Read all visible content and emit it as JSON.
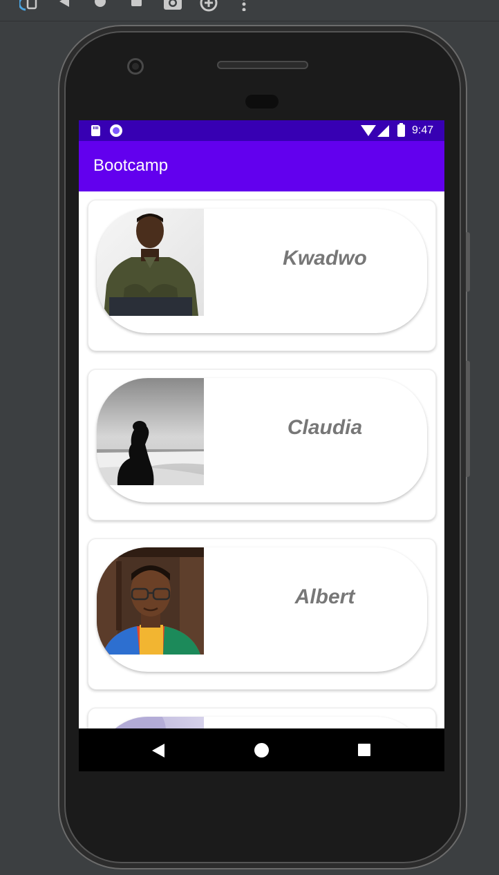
{
  "emulator_toolbar": {
    "icons": [
      "rotate-icon",
      "back-icon",
      "home-icon",
      "overview-icon",
      "screenshot-icon",
      "zoom-icon",
      "more-icon"
    ]
  },
  "status_bar": {
    "time": "9:47",
    "icons": [
      "sd-card-icon",
      "sync-icon",
      "wifi-icon",
      "signal-icon",
      "battery-icon"
    ],
    "color": "#3700b3"
  },
  "app_bar": {
    "title": "Bootcamp",
    "color": "#6200ee"
  },
  "people": [
    {
      "name": "Kwadwo",
      "photo": "man-in-olive-shirt-photo"
    },
    {
      "name": "Claudia",
      "photo": "woman-silhouette-beach-photo"
    },
    {
      "name": "Albert",
      "photo": "man-with-glasses-photo"
    },
    {
      "name": "",
      "photo": "purple-abstract-photo"
    }
  ],
  "colors": {
    "name_text": "#777777",
    "background": "#ffffff",
    "nav_bar": "#000000"
  },
  "nav_bar": {
    "icons": [
      "back-icon",
      "home-icon",
      "recents-icon"
    ]
  }
}
